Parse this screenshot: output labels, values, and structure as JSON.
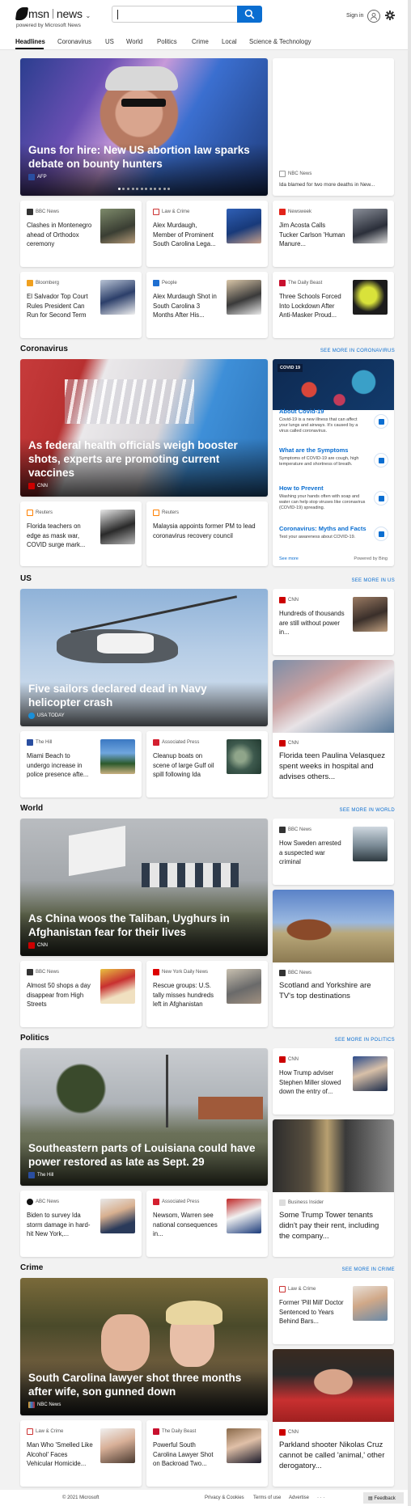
{
  "header": {
    "brand": "msn",
    "product": "news",
    "powered": "powered by Microsoft News",
    "search_placeholder": "",
    "signin": "Sign in"
  },
  "nav": [
    "Headlines",
    "Coronavirus",
    "US",
    "World",
    "Politics",
    "Crime",
    "Local",
    "Science & Technology"
  ],
  "colors": {
    "accent": "#0a6ed1",
    "bbc": "#333333",
    "cnn": "#cc0000",
    "ap": "#d42030",
    "reuters": "#ff8000"
  },
  "top": {
    "hero": {
      "title": "Guns for hire: New US abortion law sparks debate on bounty hunters",
      "source": "AFP"
    },
    "side": {
      "source": "NBC News",
      "title": "Ida blamed for two more deaths in New..."
    },
    "cards": [
      {
        "source": "BBC News",
        "title": "Clashes in Montenegro ahead of Orthodox ceremony"
      },
      {
        "source": "Law & Crime",
        "title": "Alex Murdaugh, Member of Prominent South Carolina Lega..."
      },
      {
        "source": "Newsweek",
        "title": "Jim Acosta Calls Tucker Carlson 'Human Manure..."
      },
      {
        "source": "Bloomberg",
        "title": "El Salvador Top Court Rules President Can Run for Second Term"
      },
      {
        "source": "People",
        "title": "Alex Murdaugh Shot in South Carolina 3 Months After His..."
      },
      {
        "source": "The Daily Beast",
        "title": "Three Schools Forced Into Lockdown After Anti-Masker Proud..."
      }
    ]
  },
  "coronavirus": {
    "label": "Coronavirus",
    "more": "SEE MORE IN CORONAVIRUS",
    "hero": {
      "title": "As federal health officials weigh booster shots, experts are promoting current vaccines",
      "source": "CNN"
    },
    "cards": [
      {
        "source": "Reuters",
        "title": "Florida teachers on edge as mask war, COVID surge mark..."
      },
      {
        "source": "Reuters",
        "title": "Malaysia appoints former PM to lead coronavirus recovery council"
      }
    ],
    "panel": {
      "tag": "COVID 19",
      "items": [
        {
          "title": "About Covid-19",
          "desc": "Covid-19 is a new illness that can affect your lungs and airways. It's caused by a virus called coronavirus."
        },
        {
          "title": "What are the Symptoms",
          "desc": "Symptoms of COVID-19 are cough, high temperature and shortness of breath."
        },
        {
          "title": "How to Prevent",
          "desc": "Washing your hands often with soap and water can help stop viruses like coronavirus (COVID-19) spreading."
        },
        {
          "title": "Coronavirus: Myths and Facts",
          "desc": "Test your awareness about COVID-19."
        }
      ],
      "see_more": "See more",
      "powered": "Powered by Bing"
    }
  },
  "us": {
    "label": "US",
    "more": "SEE MORE IN US",
    "hero": {
      "title": "Five sailors declared dead in Navy helicopter crash",
      "source": "USA TODAY"
    },
    "side": {
      "source": "CNN",
      "title": "Hundreds of thousands are still without power in..."
    },
    "tall": {
      "source": "CNN",
      "title": "Florida teen Paulina Velasquez spent weeks in hospital and advises others..."
    },
    "cards": [
      {
        "source": "The Hill",
        "title": "Miami Beach to undergo increase in police presence afte..."
      },
      {
        "source": "Associated Press",
        "title": "Cleanup boats on scene of large Gulf oil spill following Ida"
      }
    ]
  },
  "world": {
    "label": "World",
    "more": "SEE MORE IN WORLD",
    "hero": {
      "title": "As China woos the Taliban, Uyghurs in Afghanistan fear for their lives",
      "source": "CNN"
    },
    "side": {
      "source": "BBC News",
      "title": "How Sweden arrested a suspected war criminal"
    },
    "tall": {
      "source": "BBC News",
      "title": "Scotland and Yorkshire are TV's top destinations"
    },
    "cards": [
      {
        "source": "BBC News",
        "title": "Almost 50 shops a day disappear from High Streets"
      },
      {
        "source": "New York Daily News",
        "title": "Rescue groups: U.S. tally misses hundreds left in Afghanistan"
      }
    ]
  },
  "politics": {
    "label": "Politics",
    "more": "SEE MORE IN POLITICS",
    "hero": {
      "title": "Southeastern parts of Louisiana could have power restored as late as Sept. 29",
      "source": "The Hill"
    },
    "side": {
      "source": "CNN",
      "title": "How Trump adviser Stephen Miller slowed down the entry of..."
    },
    "tall": {
      "source": "Business Insider",
      "title": "Some Trump Tower tenants didn't pay their rent, including the company..."
    },
    "cards": [
      {
        "source": "ABC News",
        "title": "Biden to survey Ida storm damage in hard-hit New York,..."
      },
      {
        "source": "Associated Press",
        "title": "Newsom, Warren see national consequences in..."
      }
    ]
  },
  "crime": {
    "label": "Crime",
    "more": "SEE MORE IN CRIME",
    "hero": {
      "title": "South Carolina lawyer shot three months after wife, son gunned down",
      "source": "NBC News"
    },
    "side": {
      "source": "Law & Crime",
      "title": "Former 'Pill Mill' Doctor Sentenced to Years Behind Bars..."
    },
    "tall": {
      "source": "CNN",
      "title": "Parkland shooter Nikolas Cruz cannot be called 'animal,' other derogatory..."
    },
    "cards": [
      {
        "source": "Law & Crime",
        "title": "Man Who 'Smelled Like Alcohol' Faces Vehicular Homicide..."
      },
      {
        "source": "The Daily Beast",
        "title": "Powerful South Carolina Lawyer Shot on Backroad Two..."
      }
    ]
  },
  "footer": {
    "copyright": "© 2021 Microsoft",
    "privacy": "Privacy & Cookies",
    "terms": "Terms of use",
    "advertise": "Advertise",
    "more": "· · ·",
    "feedback": "Feedback"
  }
}
